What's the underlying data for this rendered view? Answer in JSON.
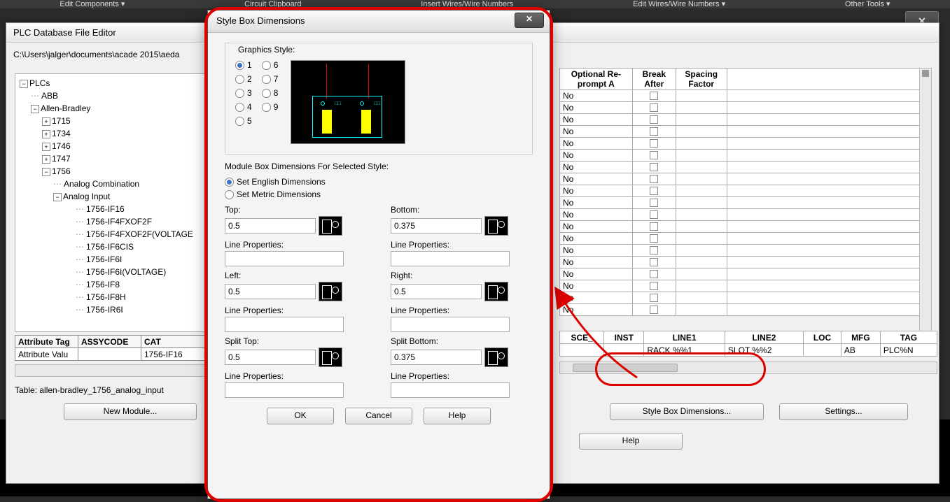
{
  "domain": "Computer-Use",
  "ribbon": {
    "edit_components": "Edit Components ▾",
    "circuit_clipboard": "Circuit Clipboard",
    "insert_wires": "Insert Wires/Wire Numbers",
    "edit_wires": "Edit Wires/Wire Numbers ▾",
    "other_tools": "Other Tools ▾"
  },
  "editor": {
    "title": "PLC Database File Editor",
    "path": "C:\\Users\\jalger\\documents\\acade 2015\\aeda",
    "table_name": "Table: allen-bradley_1756_analog_input",
    "buttons": {
      "new_module": "New Module...",
      "style_box": "Style Box Dimensions...",
      "settings": "Settings...",
      "help": "Help"
    }
  },
  "tree": {
    "root": "PLCs",
    "abb": "ABB",
    "ab": "Allen-Bradley",
    "n1715": "1715",
    "n1734": "1734",
    "n1746": "1746",
    "n1747": "1747",
    "n1756": "1756",
    "analog_combo": "Analog Combination",
    "analog_input": "Analog Input",
    "items": [
      "1756-IF16",
      "1756-IF4FXOF2F",
      "1756-IF4FXOF2F(VOLTAGE",
      "1756-IF6CIS",
      "1756-IF6I",
      "1756-IF6I(VOLTAGE)",
      "1756-IF8",
      "1756-IF8H",
      "1756-IR6I"
    ]
  },
  "attr_table": {
    "h1": "Attribute Tag",
    "h2": "ASSYCODE",
    "h3": "CAT",
    "r1": "Attribute Valu",
    "c3": "1756-IF16"
  },
  "right_headers": {
    "c1": "Optional Re-prompt A",
    "c2": "Break After",
    "c3": "Spacing Factor"
  },
  "right_rows": [
    "No",
    "No",
    "No",
    "No",
    "No",
    "No",
    "No",
    "No",
    "No",
    "No",
    "No",
    "No",
    "No",
    "No",
    "No",
    "No",
    "No",
    "No",
    "No"
  ],
  "cols_table": {
    "h": [
      "SCE_",
      "INST",
      "LINE1",
      "LINE2",
      "LOC",
      "MFG",
      "TAG"
    ],
    "r": [
      "",
      "",
      "RACK %%1",
      "SLOT %%2",
      "",
      "AB",
      "PLC%N"
    ]
  },
  "dialog": {
    "title": "Style Box Dimensions",
    "graphics_style": "Graphics Style:",
    "style_nums": [
      "1",
      "2",
      "3",
      "4",
      "5",
      "6",
      "7",
      "8",
      "9"
    ],
    "selected_style": 1,
    "mod_box_title": "Module Box Dimensions For Selected Style:",
    "set_english": "Set English Dimensions",
    "set_metric": "Set Metric Dimensions",
    "labels": {
      "top": "Top:",
      "bottom": "Bottom:",
      "left": "Left:",
      "right": "Right:",
      "split_top": "Split Top:",
      "split_bottom": "Split Bottom:",
      "line_props": "Line Properties:"
    },
    "values": {
      "top": "0.5",
      "bottom": "0.375",
      "left": "0.5",
      "right": "0.5",
      "split_top": "0.5",
      "split_bottom": "0.375"
    },
    "buttons": {
      "ok": "OK",
      "cancel": "Cancel",
      "help": "Help"
    }
  }
}
